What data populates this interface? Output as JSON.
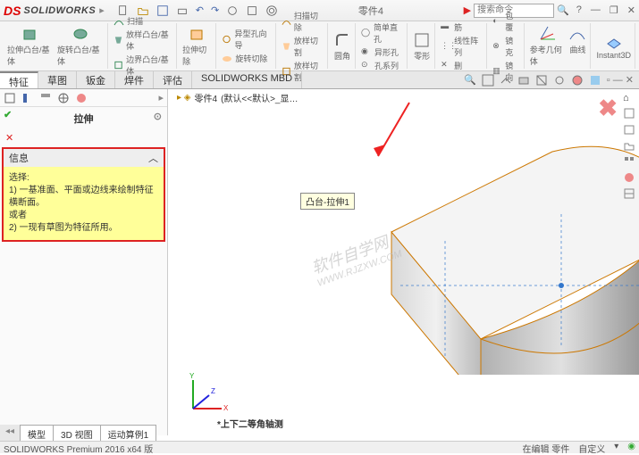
{
  "app": {
    "logo_text": "SOLIDWORKS",
    "doc_title": "零件4",
    "search_placeholder": "搜索命令"
  },
  "ribbon": {
    "groups": [
      {
        "items": [
          {
            "label": "拉伸凸台/基体"
          },
          {
            "label": "旋转凸台/基体"
          }
        ]
      },
      {
        "small": [
          {
            "label": "扫描"
          },
          {
            "label": "放样凸台/基体"
          },
          {
            "label": "边界凸台/基体"
          }
        ]
      },
      {
        "items": [
          {
            "label": "拉伸切除"
          }
        ]
      },
      {
        "small": [
          {
            "label": "异型孔向导"
          },
          {
            "label": "旋转切除"
          }
        ]
      },
      {
        "small": [
          {
            "label": "扫描切除"
          },
          {
            "label": "放样切割"
          },
          {
            "label": "放样切割"
          }
        ]
      },
      {
        "items": [
          {
            "label": "圆角"
          }
        ]
      },
      {
        "small": [
          {
            "label": "简单直孔"
          },
          {
            "label": "异形孔"
          },
          {
            "label": "孔系列"
          }
        ]
      },
      {
        "items": [
          {
            "label": "零形"
          }
        ]
      },
      {
        "small": [
          {
            "label": "筋"
          },
          {
            "label": "线性阵列"
          },
          {
            "label": "删"
          }
        ]
      },
      {
        "small": [
          {
            "label": "包覆"
          },
          {
            "label": "镜克"
          },
          {
            "label": "镜向"
          }
        ]
      },
      {
        "items": [
          {
            "label": "参考几何体"
          },
          {
            "label": "曲线"
          }
        ]
      },
      {
        "items": [
          {
            "label": "Instant3D"
          }
        ]
      }
    ]
  },
  "tabs": {
    "items": [
      "特征",
      "草图",
      "钣金",
      "焊件",
      "评估",
      "SOLIDWORKS MBD"
    ],
    "active": 0
  },
  "panel": {
    "title": "拉伸",
    "info_header": "信息",
    "info_body_1": "选择:",
    "info_body_2": "1) 一基准面、平面或边线来绘制特征横断面。",
    "info_body_3": "或者",
    "info_body_4": "2) 一现有草图为特征所用。"
  },
  "viewport": {
    "breadcrumb_part": "零件4",
    "breadcrumb_config": "(默认<<默认>_显…",
    "tooltip": "凸台-拉伸1",
    "orientation": "*上下二等角轴测",
    "watermark": "软件自学网",
    "watermark_url": "WWW.RJZXW.COM"
  },
  "doc_tabs": [
    "模型",
    "3D 视图",
    "运动算例1"
  ],
  "statusbar": {
    "left": "SOLIDWORKS Premium 2016 x64 版",
    "right_1": "在编辑 零件",
    "right_2": "自定义"
  }
}
